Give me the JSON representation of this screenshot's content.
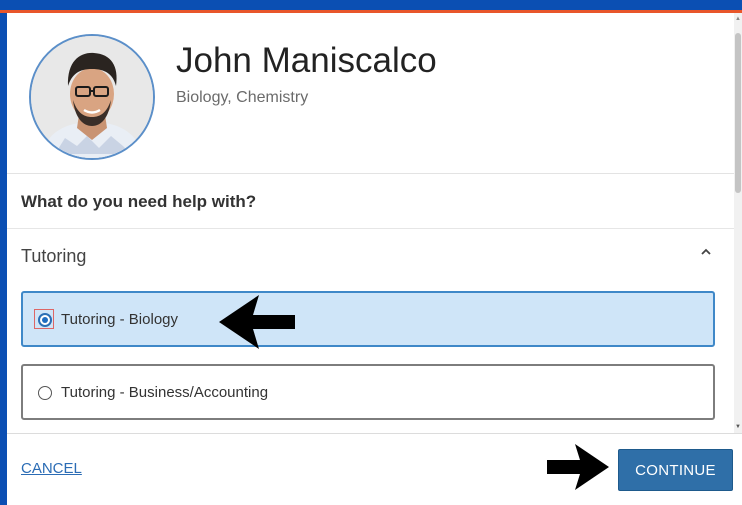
{
  "tutor": {
    "name": "John Maniscalco",
    "subjects": "Biology, Chemistry"
  },
  "question": "What do you need help with?",
  "section": {
    "label": "Tutoring",
    "expanded": true
  },
  "options": [
    {
      "label": "Tutoring - Biology",
      "selected": true
    },
    {
      "label": "Tutoring - Business/Accounting",
      "selected": false
    }
  ],
  "footer": {
    "cancel_label": "CANCEL",
    "continue_label": "CONTINUE"
  },
  "colors": {
    "brand_blue": "#0b4fb3",
    "accent_orange": "#e8562a",
    "selected_bg": "#cfe5f8",
    "button_blue": "#2f6fa8"
  }
}
